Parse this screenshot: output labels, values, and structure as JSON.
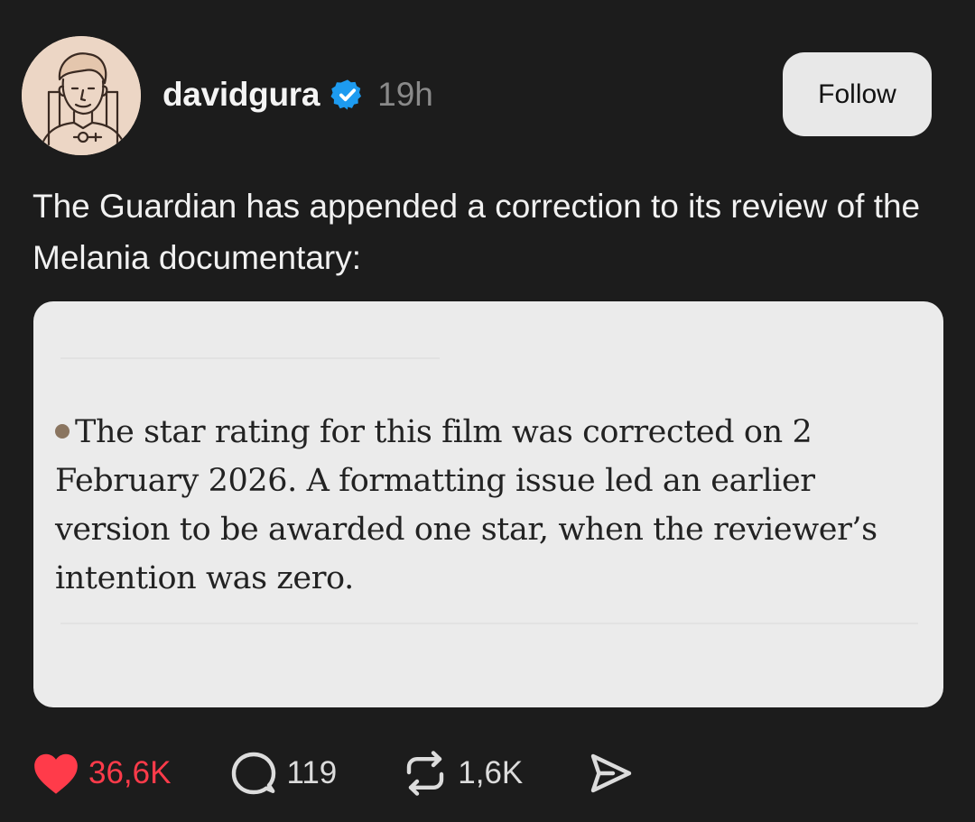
{
  "post": {
    "username": "davidgura",
    "verified": true,
    "timestamp": "19h",
    "follow_label": "Follow",
    "text": "The Guardian has appended a correction to its review of the Melania documentary:",
    "quote": {
      "text": "The star rating for this film was corrected on 2 February 2026. A formatting issue led an earlier version to be awarded one star, when the reviewer’s intention was zero."
    },
    "actions": {
      "likes": "36,6K",
      "replies": "119",
      "reposts": "1,6K"
    }
  },
  "colors": {
    "background": "#1c1c1c",
    "verified": "#1d9bf0",
    "like": "#ff3b4a",
    "follow_button": "#e8e8e8",
    "card": "#ebebeb"
  },
  "icons": [
    "verified-badge-icon",
    "heart-icon",
    "reply-bubble-icon",
    "repost-icon",
    "share-send-icon",
    "bullet-icon"
  ]
}
